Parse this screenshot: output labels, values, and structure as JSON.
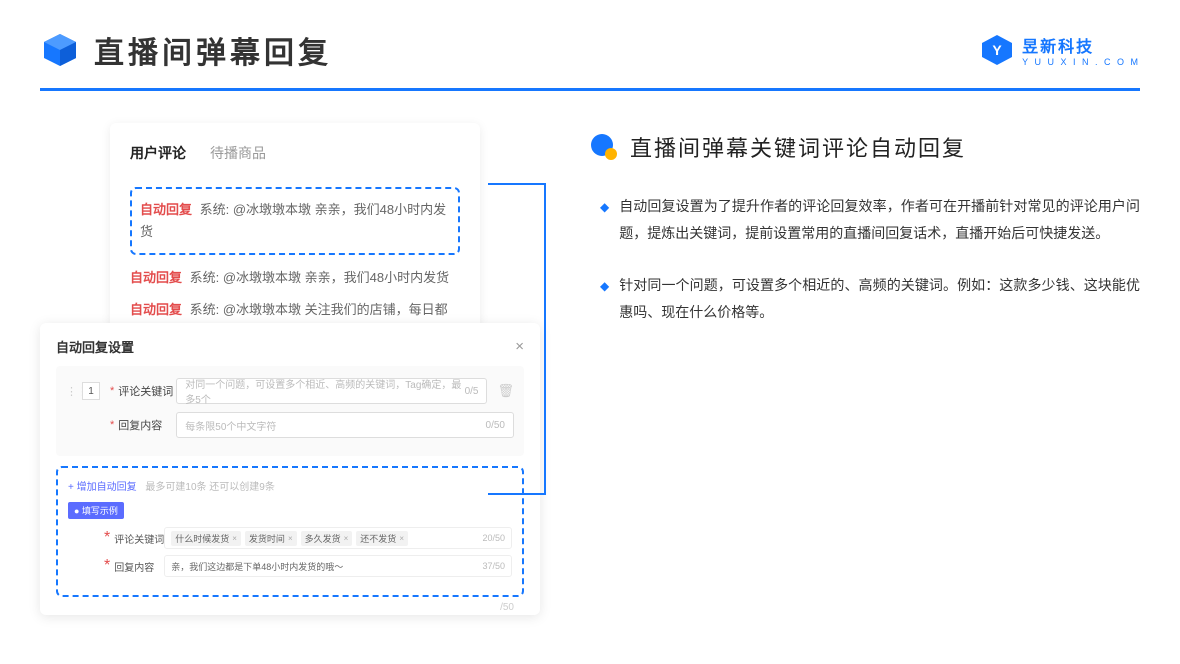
{
  "header": {
    "title": "直播间弹幕回复"
  },
  "brand": {
    "cn": "昱新科技",
    "en": "Y U U X I N . C O M"
  },
  "comment_card": {
    "tabs": {
      "active": "用户评论",
      "inactive": "待播商品"
    },
    "highlighted": {
      "tag": "自动回复",
      "text": "系统: @冰墩墩本墩 亲亲，我们48小时内发货"
    },
    "lines": [
      {
        "tag": "自动回复",
        "text": "系统: @冰墩墩本墩 亲亲，我们48小时内发货"
      },
      {
        "tag": "自动回复",
        "text": "系统: @冰墩墩本墩 关注我们的店铺，每日都有热门推荐呦～"
      }
    ]
  },
  "settings": {
    "title": "自动回复设置",
    "order": "1",
    "keyword_label": "评论关键词",
    "keyword_placeholder": "对同一个问题，可设置多个相近、高频的关键词，Tag确定，最多5个",
    "keyword_count": "0/5",
    "content_label": "回复内容",
    "content_placeholder": "每条限50个中文字符",
    "content_count": "0/50",
    "add_label": "+ 增加自动回复",
    "add_hint": "最多可建10条 还可以创建9条",
    "example_badge": "● 填写示例",
    "ex_keyword_label": "评论关键词",
    "ex_tags": [
      "什么时候发货",
      "发货时间",
      "多久发货",
      "还不发货"
    ],
    "ex_keyword_count": "20/50",
    "ex_content_label": "回复内容",
    "ex_content_text": "亲，我们这边都是下单48小时内发货的哦～",
    "ex_content_count": "37/50",
    "stray_count": "/50"
  },
  "right": {
    "title": "直播间弹幕关键词评论自动回复",
    "bullets": [
      "自动回复设置为了提升作者的评论回复效率，作者可在开播前针对常见的评论用户问题，提炼出关键词，提前设置常用的直播间回复话术，直播开始后可快捷发送。",
      "针对同一个问题，可设置多个相近的、高频的关键词。例如：这款多少钱、这块能优惠吗、现在什么价格等。"
    ]
  }
}
